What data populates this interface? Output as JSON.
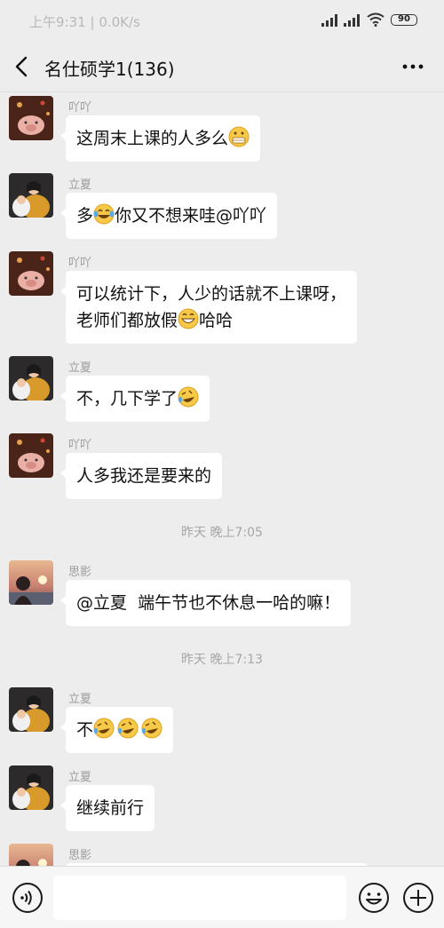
{
  "status_bar": {
    "time": "上午9:31",
    "net_speed": "0.0K/s",
    "separator": "|",
    "battery": "90"
  },
  "header": {
    "title": "名仕硕学1(136)"
  },
  "messages": [
    {
      "sender": "吖吖",
      "text": "这周末上课的人多么",
      "emoji": [
        "grimace-emoji"
      ]
    },
    {
      "sender": "立夏",
      "text_before": "多",
      "text_after": "你又不想来哇@吖吖",
      "emoji": [
        "tears-of-joy-emoji"
      ]
    },
    {
      "sender": "吖吖",
      "line1": "可以统计下，人少的话就不上课呀，",
      "line2_before": "老师们都放假",
      "line2_after": "哈哈",
      "emoji": [
        "grin-emoji"
      ]
    },
    {
      "sender": "立夏",
      "text": "不，几下学了",
      "emoji": [
        "rofl-emoji"
      ]
    },
    {
      "sender": "吖吖",
      "text": "人多我还是要来的"
    },
    {
      "sender": "思影",
      "text": "@立夏  端午节也不休息一哈的嘛！"
    },
    {
      "sender": "立夏",
      "text": "不",
      "emoji": [
        "rofl-emoji",
        "rofl-emoji",
        "rofl-emoji"
      ]
    },
    {
      "sender": "立夏",
      "text": "继续前行"
    },
    {
      "sender": "思影"
    }
  ],
  "timestamps": [
    "昨天 晚上7:05",
    "昨天 晚上7:13"
  ],
  "icons": {
    "back": "back-arrow-icon",
    "more": "more-dots-icon",
    "voice": "voice-icon",
    "emoji": "emoji-face-icon",
    "plus": "plus-icon"
  },
  "colors": {
    "background": "#ededed",
    "bubble": "#ffffff",
    "meta_text": "#a6a6a6"
  }
}
